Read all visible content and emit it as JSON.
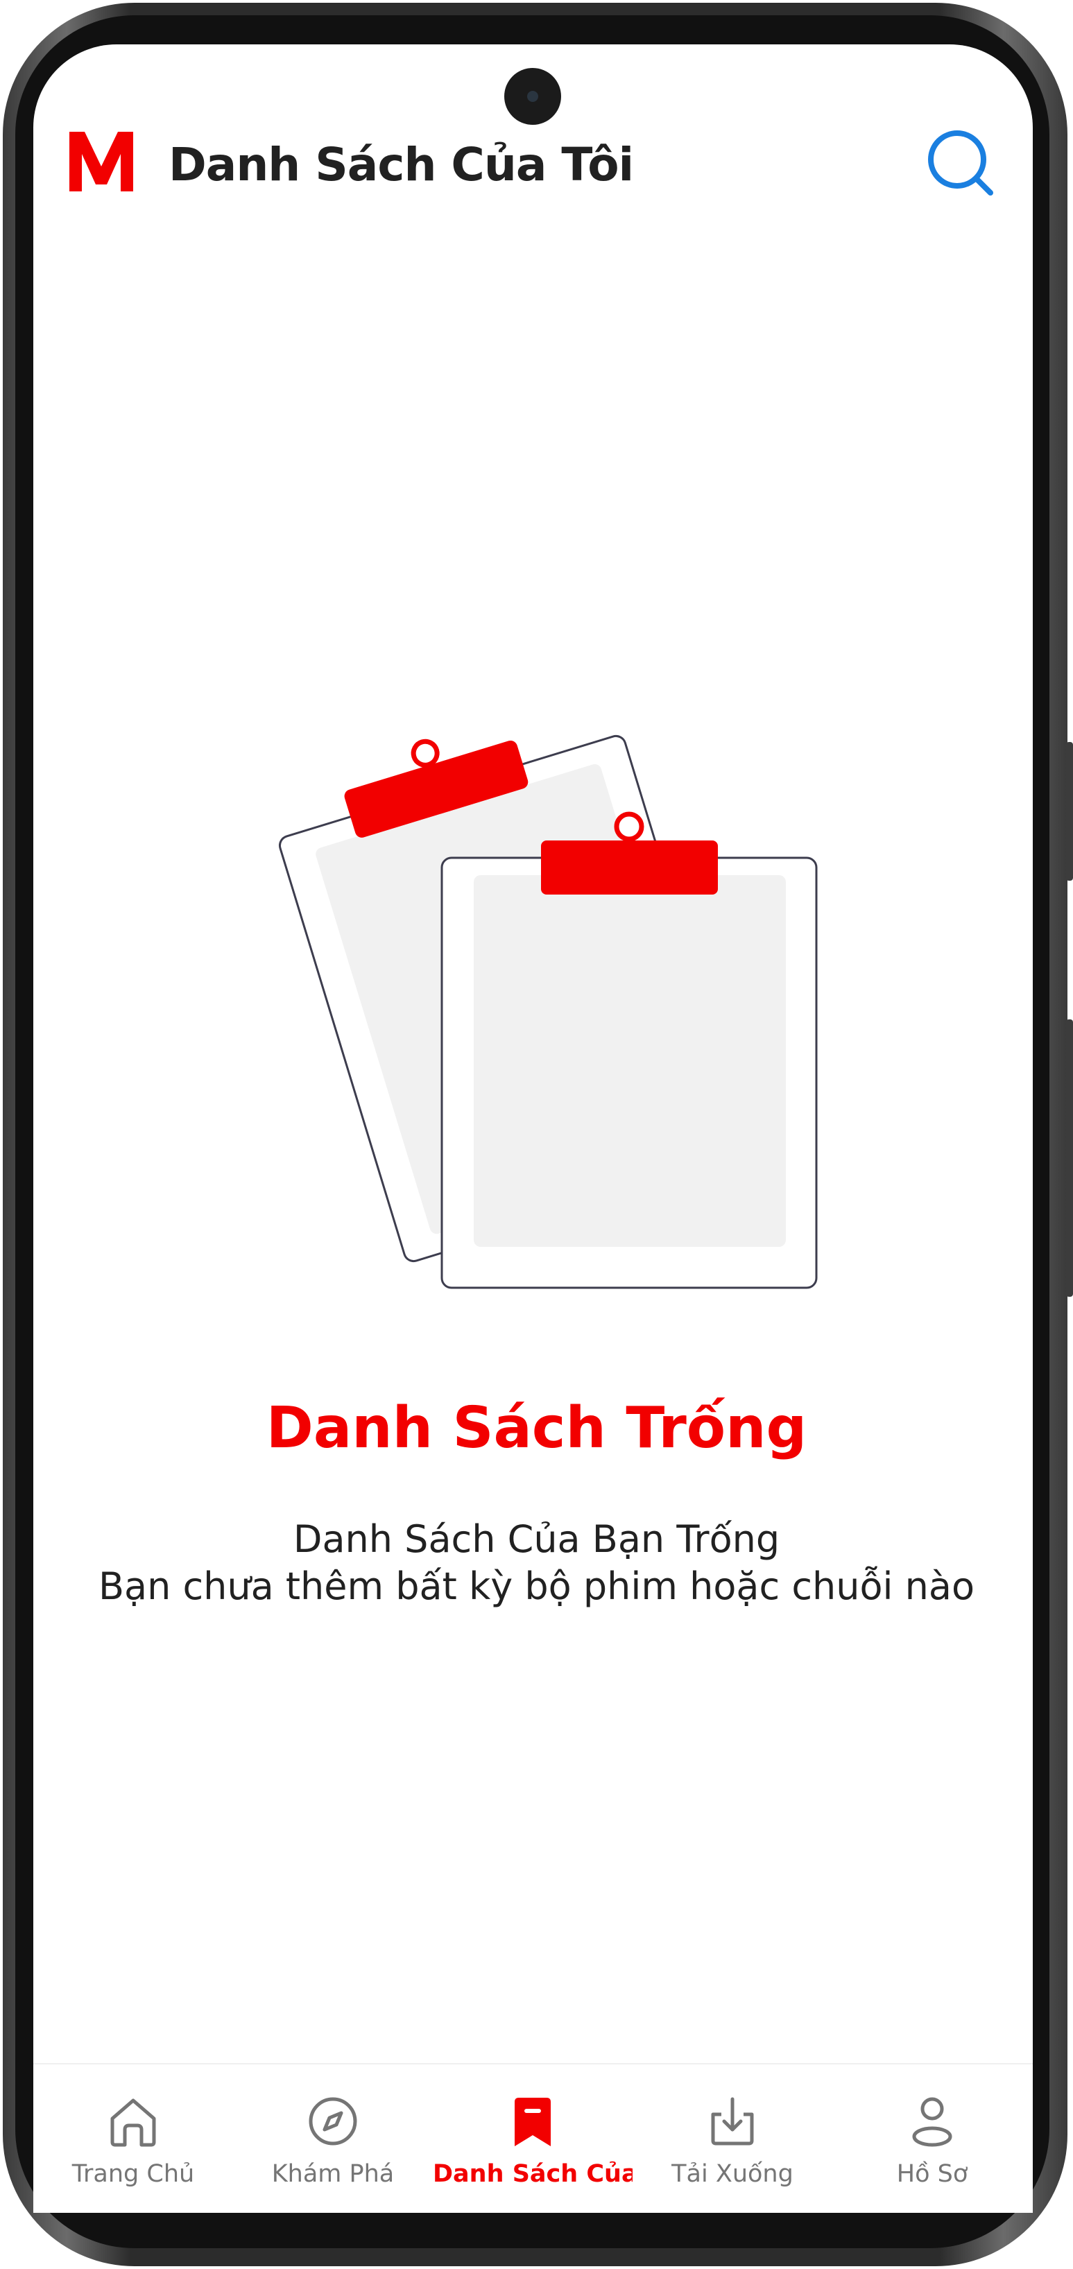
{
  "header": {
    "logo_letter": "M",
    "title": "Danh Sách Của Tôi"
  },
  "empty_state": {
    "title": "Danh Sách Trống",
    "line1": "Danh Sách Của Bạn Trống",
    "line2": "Bạn chưa thêm bất kỳ bộ phim hoặc chuỗi nào"
  },
  "bottom_nav": {
    "items": [
      {
        "label": "Trang Chủ",
        "icon": "home-icon",
        "active": false
      },
      {
        "label": "Khám Phá",
        "icon": "compass-icon",
        "active": false
      },
      {
        "label": "Danh Sách Của ...",
        "icon": "bookmark-icon",
        "active": true
      },
      {
        "label": "Tải Xuống",
        "icon": "download-icon",
        "active": false
      },
      {
        "label": "Hồ Sơ",
        "icon": "profile-icon",
        "active": false
      }
    ]
  },
  "colors": {
    "brand": "#f20000",
    "search_accent": "#1a7fe0",
    "text": "#212121",
    "inactive": "#757575"
  }
}
